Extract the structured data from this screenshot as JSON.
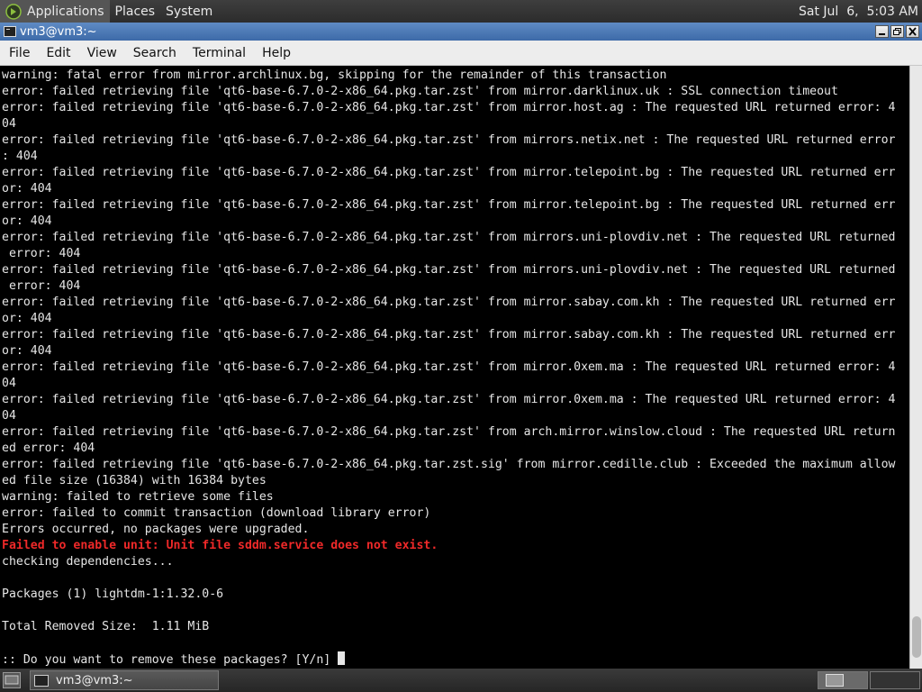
{
  "top_panel": {
    "applications_label": "Applications",
    "places_label": "Places",
    "system_label": "System",
    "clock": "Sat Jul  6,  5:03 AM"
  },
  "window": {
    "title": "vm3@vm3:~"
  },
  "menubar": {
    "items": [
      "File",
      "Edit",
      "View",
      "Search",
      "Terminal",
      "Help"
    ]
  },
  "terminal": {
    "lines": [
      {
        "text": "warning: fatal error from mirror.archlinux.bg, skipping for the remainder of this transaction",
        "style": "normal"
      },
      {
        "text": "error: failed retrieving file 'qt6-base-6.7.0-2-x86_64.pkg.tar.zst' from mirror.darklinux.uk : SSL connection timeout",
        "style": "normal"
      },
      {
        "text": "error: failed retrieving file 'qt6-base-6.7.0-2-x86_64.pkg.tar.zst' from mirror.host.ag : The requested URL returned error: 4",
        "style": "normal"
      },
      {
        "text": "04",
        "style": "normal"
      },
      {
        "text": "error: failed retrieving file 'qt6-base-6.7.0-2-x86_64.pkg.tar.zst' from mirrors.netix.net : The requested URL returned error",
        "style": "normal"
      },
      {
        "text": ": 404",
        "style": "normal"
      },
      {
        "text": "error: failed retrieving file 'qt6-base-6.7.0-2-x86_64.pkg.tar.zst' from mirror.telepoint.bg : The requested URL returned err",
        "style": "normal"
      },
      {
        "text": "or: 404",
        "style": "normal"
      },
      {
        "text": "error: failed retrieving file 'qt6-base-6.7.0-2-x86_64.pkg.tar.zst' from mirror.telepoint.bg : The requested URL returned err",
        "style": "normal"
      },
      {
        "text": "or: 404",
        "style": "normal"
      },
      {
        "text": "error: failed retrieving file 'qt6-base-6.7.0-2-x86_64.pkg.tar.zst' from mirrors.uni-plovdiv.net : The requested URL returned",
        "style": "normal"
      },
      {
        "text": " error: 404",
        "style": "normal"
      },
      {
        "text": "error: failed retrieving file 'qt6-base-6.7.0-2-x86_64.pkg.tar.zst' from mirrors.uni-plovdiv.net : The requested URL returned",
        "style": "normal"
      },
      {
        "text": " error: 404",
        "style": "normal"
      },
      {
        "text": "error: failed retrieving file 'qt6-base-6.7.0-2-x86_64.pkg.tar.zst' from mirror.sabay.com.kh : The requested URL returned err",
        "style": "normal"
      },
      {
        "text": "or: 404",
        "style": "normal"
      },
      {
        "text": "error: failed retrieving file 'qt6-base-6.7.0-2-x86_64.pkg.tar.zst' from mirror.sabay.com.kh : The requested URL returned err",
        "style": "normal"
      },
      {
        "text": "or: 404",
        "style": "normal"
      },
      {
        "text": "error: failed retrieving file 'qt6-base-6.7.0-2-x86_64.pkg.tar.zst' from mirror.0xem.ma : The requested URL returned error: 4",
        "style": "normal"
      },
      {
        "text": "04",
        "style": "normal"
      },
      {
        "text": "error: failed retrieving file 'qt6-base-6.7.0-2-x86_64.pkg.tar.zst' from mirror.0xem.ma : The requested URL returned error: 4",
        "style": "normal"
      },
      {
        "text": "04",
        "style": "normal"
      },
      {
        "text": "error: failed retrieving file 'qt6-base-6.7.0-2-x86_64.pkg.tar.zst' from arch.mirror.winslow.cloud : The requested URL return",
        "style": "normal"
      },
      {
        "text": "ed error: 404",
        "style": "normal"
      },
      {
        "text": "error: failed retrieving file 'qt6-base-6.7.0-2-x86_64.pkg.tar.zst.sig' from mirror.cedille.club : Exceeded the maximum allow",
        "style": "normal"
      },
      {
        "text": "ed file size (16384) with 16384 bytes",
        "style": "normal"
      },
      {
        "text": "warning: failed to retrieve some files",
        "style": "normal"
      },
      {
        "text": "error: failed to commit transaction (download library error)",
        "style": "normal"
      },
      {
        "text": "Errors occurred, no packages were upgraded.",
        "style": "normal"
      },
      {
        "text": "Failed to enable unit: Unit file sddm.service does not exist.",
        "style": "err"
      },
      {
        "text": "checking dependencies...",
        "style": "normal"
      },
      {
        "text": "",
        "style": "normal"
      },
      {
        "text": "Packages (1) lightdm-1:1.32.0-6",
        "style": "normal"
      },
      {
        "text": "",
        "style": "normal"
      },
      {
        "text": "Total Removed Size:  1.11 MiB",
        "style": "normal"
      },
      {
        "text": "",
        "style": "normal"
      }
    ],
    "prompt": ":: Do you want to remove these packages? [Y/n] "
  },
  "taskbar": {
    "task_title": "vm3@vm3:~"
  },
  "colors": {
    "terminal_bg": "#000000",
    "terminal_fg": "#e6e6e6",
    "error_red": "#ef2929",
    "titlebar_blue": "#4a78b6"
  }
}
